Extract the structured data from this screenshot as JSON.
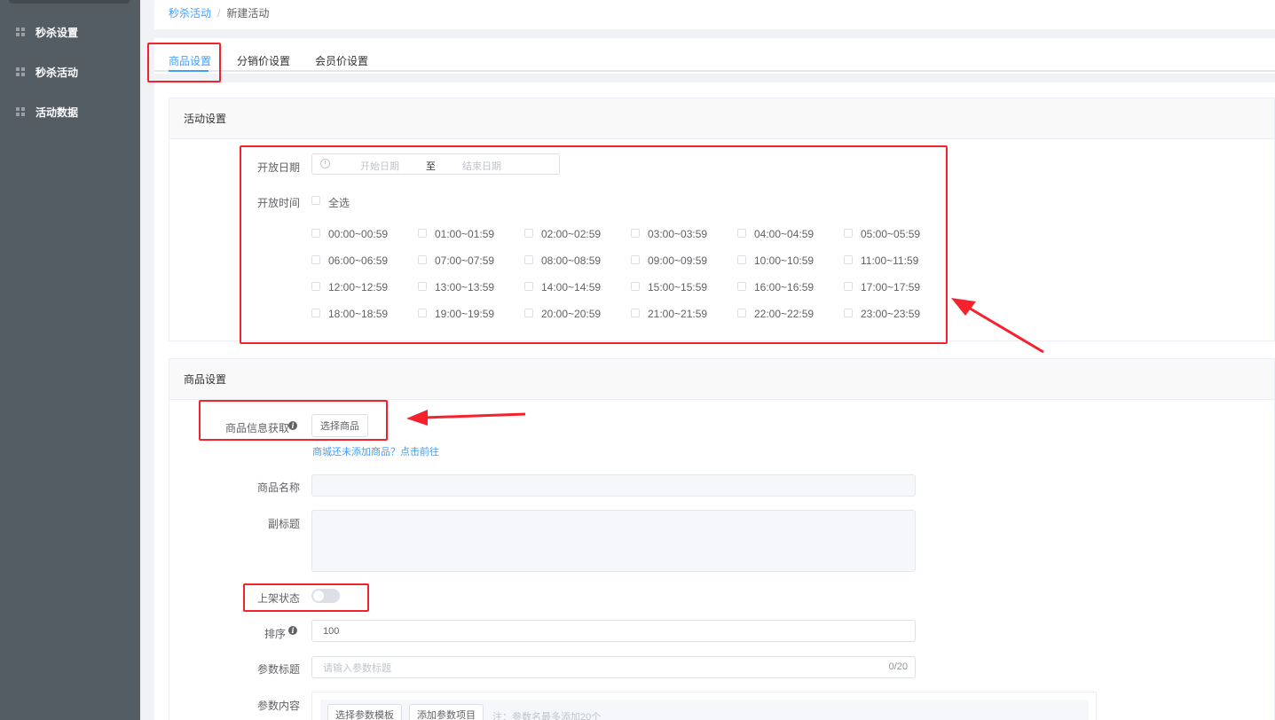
{
  "sidebar": {
    "items": [
      {
        "label": "秒杀设置",
        "icon": "grid-icon"
      },
      {
        "label": "秒杀活动",
        "icon": "grid-icon"
      },
      {
        "label": "活动数据",
        "icon": "grid-icon"
      }
    ]
  },
  "breadcrumb": {
    "parent": "秒杀活动",
    "separator": "/",
    "current": "新建活动"
  },
  "tabs": [
    {
      "label": "商品设置",
      "active": true
    },
    {
      "label": "分销价设置",
      "active": false
    },
    {
      "label": "会员价设置",
      "active": false
    }
  ],
  "activity": {
    "header": "活动设置",
    "date_label": "开放日期",
    "start_placeholder": "开始日期",
    "range_separator": "至",
    "end_placeholder": "结束日期",
    "time_label": "开放时间",
    "select_all": "全选",
    "slots": [
      "00:00~00:59",
      "01:00~01:59",
      "02:00~02:59",
      "03:00~03:59",
      "04:00~04:59",
      "05:00~05:59",
      "06:00~06:59",
      "07:00~07:59",
      "08:00~08:59",
      "09:00~09:59",
      "10:00~10:59",
      "11:00~11:59",
      "12:00~12:59",
      "13:00~13:59",
      "14:00~14:59",
      "15:00~15:59",
      "16:00~16:59",
      "17:00~17:59",
      "18:00~18:59",
      "19:00~19:59",
      "20:00~20:59",
      "21:00~21:59",
      "22:00~22:59",
      "23:00~23:59"
    ]
  },
  "product": {
    "header": "商品设置",
    "info_label": "商品信息获取",
    "select_button": "选择商品",
    "add_link": "商城还未添加商品？点击前往",
    "name_label": "商品名称",
    "name_value": "",
    "subtitle_label": "副标题",
    "subtitle_value": "",
    "status_label": "上架状态",
    "status_on": false,
    "sort_label": "排序",
    "sort_value": "100",
    "param_title_label": "参数标题",
    "param_title_placeholder": "请输入参数标题",
    "param_title_count": "0/20",
    "param_content_label": "参数内容",
    "template_button": "选择参数模板",
    "add_param_button": "添加参数项目",
    "param_note": "注：参数名最多添加20个"
  },
  "colors": {
    "accent": "#409eff",
    "sidebar_bg": "#545c64",
    "annotation": "#f5222d"
  }
}
